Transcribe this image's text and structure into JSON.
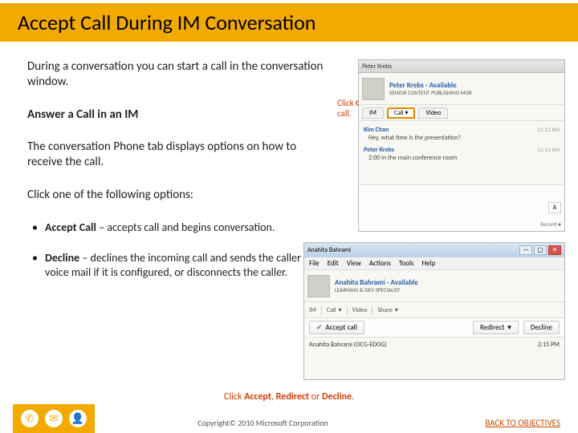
{
  "title": "Accept Call During IM Conversation",
  "intro": "During a conversation you can start a call in the conversation window.",
  "subhead": "Answer a Call in an IM",
  "phone_tab": "The conversation Phone tab displays options on how to receive the call.",
  "options_lead": "Click one of the following options:",
  "options": [
    {
      "name": "Accept Call",
      "desc": " – accepts call and begins conversation."
    },
    {
      "name": "Decline",
      "desc": " – declines the incoming call and sends the caller to voice mail if it is configured, or disconnects the caller."
    }
  ],
  "callout1_pre": "Click ",
  "callout1_b": "Call",
  "callout1_post": " to initiate call.",
  "callout2_pre": "Click ",
  "callout2_b1": "Accept",
  "callout2_mid1": ", ",
  "callout2_b2": "Redirect",
  "callout2_mid2": " or ",
  "callout2_b3": "Decline",
  "callout2_end": ".",
  "screenshot1": {
    "window_title": "Peter Krebs",
    "name": "Peter Krebs",
    "status_line1": "Available",
    "status_line2": "SENIOR CONTENT PUBLISHING MGR",
    "tabs": {
      "im": "IM",
      "call": "Call",
      "video": "Video"
    },
    "messages": [
      {
        "sender": "Kim Chan",
        "time": "11:13 AM",
        "body": "Hey, what time is the presentation?"
      },
      {
        "sender": "Peter Krebs",
        "time": "11:13 AM",
        "body": "2:00 in the main conference room"
      }
    ],
    "a_button": "A",
    "send_label": "Record"
  },
  "screenshot2": {
    "window_title": "Anahita Bahrami",
    "menus": {
      "file": "File",
      "edit": "Edit",
      "view": "View",
      "actions": "Actions",
      "tools": "Tools",
      "help": "Help"
    },
    "name": "Anahita Bahrami",
    "status_line1": "Available",
    "status_line2": "LEARNING & DEV SPECIALIST",
    "tabs": {
      "im": "IM",
      "call": "Call",
      "video": "Video",
      "share": "Share"
    },
    "accept": "Accept call",
    "redirect": "Redirect",
    "decline": "Decline",
    "caller": "Anahita Bahrami (OCG-EDOG)",
    "time": "2:15 PM"
  },
  "footer": {
    "copyright": "Copyright© 2010 Microsoft Corporation",
    "back": "BACK TO OBJECTIVES"
  },
  "icons": {
    "phone": "✆",
    "chat": "✉",
    "person": "👤",
    "check": "✔",
    "down": "▾",
    "min": "—",
    "max": "▢",
    "close": "✕"
  }
}
